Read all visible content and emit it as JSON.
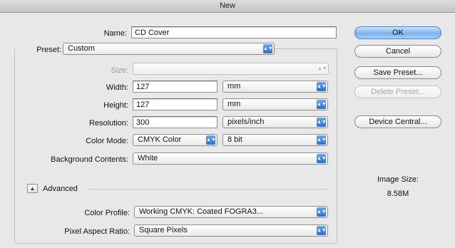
{
  "window": {
    "title": "New"
  },
  "form": {
    "name_label": "Name:",
    "name_value": "CD Cover",
    "preset_label": "Preset:",
    "preset_value": "Custom",
    "size_label": "Size:",
    "size_value": "",
    "width_label": "Width:",
    "width_value": "127",
    "width_unit": "mm",
    "height_label": "Height:",
    "height_value": "127",
    "height_unit": "mm",
    "resolution_label": "Resolution:",
    "resolution_value": "300",
    "resolution_unit": "pixels/inch",
    "color_mode_label": "Color Mode:",
    "color_mode_value": "CMYK Color",
    "bit_depth_value": "8 bit",
    "background_label": "Background Contents:",
    "background_value": "White",
    "advanced_label": "Advanced",
    "color_profile_label": "Color Profile:",
    "color_profile_value": "Working CMYK:  Coated FOGRA3...",
    "pixel_aspect_label": "Pixel Aspect Ratio:",
    "pixel_aspect_value": "Square Pixels"
  },
  "buttons": {
    "ok": "OK",
    "cancel": "Cancel",
    "save_preset": "Save Preset...",
    "delete_preset": "Delete Preset...",
    "device_central": "Device Central..."
  },
  "info": {
    "image_size_label": "Image Size:",
    "image_size_value": "8.58M"
  },
  "colors": {
    "default_button": "#7fb1ec",
    "popup_arrow": "#2f6fc8"
  },
  "icons": [
    "popup-arrows-icon",
    "disclosure-triangle-icon"
  ]
}
